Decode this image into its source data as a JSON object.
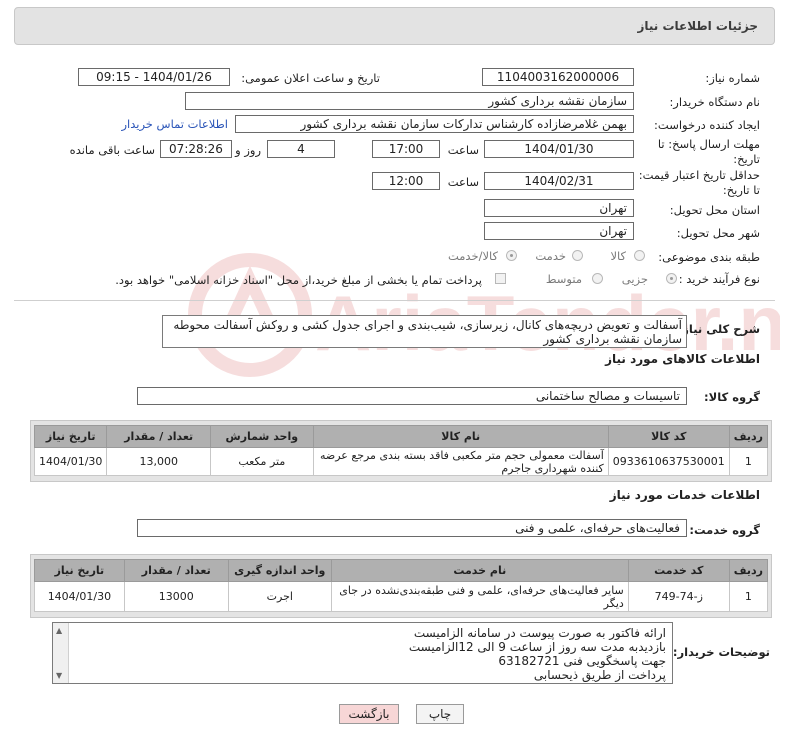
{
  "header": {
    "title": "جزئیات اطلاعات نیاز"
  },
  "fields": {
    "need_number_label": "شماره نیاز:",
    "need_number": "1104003162000006",
    "announce_label": "تاریخ و ساعت اعلان عمومی:",
    "announce_value": "1404/01/26 - 09:15",
    "buyer_org_label": "نام دستگاه خریدار:",
    "buyer_org": "سازمان نقشه برداری کشور",
    "creator_label": "ایجاد کننده درخواست:",
    "creator": "بهمن غلامرضازاده کارشناس تدارکات  سازمان نقشه برداری کشور",
    "contact_link": "اطلاعات تماس خریدار",
    "deadline_label_1": "مهلت ارسال پاسخ: تا",
    "deadline_label_2": "تاریخ:",
    "deadline_date": "1404/01/30",
    "time_label": "ساعت",
    "deadline_time": "17:00",
    "days_value": "4",
    "days_label": "روز و",
    "remaining_time": "07:28:26",
    "remaining_label": "ساعت باقی مانده",
    "validity_label_1": "حداقل تاریخ اعتبار قیمت:",
    "validity_label_2": "تا تاریخ:",
    "validity_date": "1404/02/31",
    "validity_time": "12:00",
    "province_label": "استان محل تحویل:",
    "province": "تهران",
    "city_label": "شهر محل تحویل:",
    "city": "تهران",
    "category_label": "طبقه بندی موضوعی:",
    "category_options": [
      "کالا",
      "خدمت",
      "کالا/خدمت"
    ],
    "process_label": "نوع فرآیند خرید :",
    "process_options": [
      "جزیی",
      "متوسط"
    ],
    "payment_note": "پرداخت تمام یا بخشی از مبلغ خرید،از محل \"اسناد خزانه اسلامی\" خواهد بود.",
    "description_label": "شرح کلی نیاز:",
    "description": "آسفالت و تعویض دریچه‌های کانال، زیرسازی، شیب‌بندی و اجرای جدول کشی و روکش آسفالت محوطه سازمان نقشه برداری کشور"
  },
  "goods": {
    "section_title": "اطلاعات کالاهای مورد نیاز",
    "group_label": "گروه کالا:",
    "group_value": "تاسیسات و مصالح ساختمانی",
    "headers": [
      "ردیف",
      "کد کالا",
      "نام کالا",
      "واحد شمارش",
      "تعداد / مقدار",
      "تاریخ نیاز"
    ],
    "rows": [
      [
        "1",
        "0933610637530001",
        "آسفالت معمولی حجم متر مکعبی فاقد بسته بندی مرجع عرضه کننده شهرداری جاجرم",
        "متر مکعب",
        "13,000",
        "1404/01/30"
      ]
    ]
  },
  "services": {
    "section_title": "اطلاعات خدمات مورد نیاز",
    "group_label": "گروه خدمت:",
    "group_value": "فعالیت‌های حرفه‌ای، علمی و فنی",
    "headers": [
      "ردیف",
      "کد خدمت",
      "نام خدمت",
      "واحد اندازه گیری",
      "تعداد / مقدار",
      "تاریخ نیاز"
    ],
    "rows": [
      [
        "1",
        "ز-74-749",
        "سایر فعالیت‌های حرفه‌ای، علمی و فنی طبقه‌بندی‌نشده در جای دیگر",
        "اجرت",
        "13000",
        "1404/01/30"
      ]
    ]
  },
  "buyer_notes": {
    "label": "توضیحات خریدار:",
    "lines": [
      "ارائه فاکتور به صورت پیوست در سامانه  الزامیست",
      "بازدیدبه مدت سه روز از ساعت 9 الی 12الزامیست",
      "جهت پاسخگویی فنی 63182721",
      "پرداخت از طریق ذیحسابی"
    ]
  },
  "buttons": {
    "print": "چاپ",
    "back": "بازگشت"
  },
  "watermark": {
    "text": "AriaTender.net"
  }
}
